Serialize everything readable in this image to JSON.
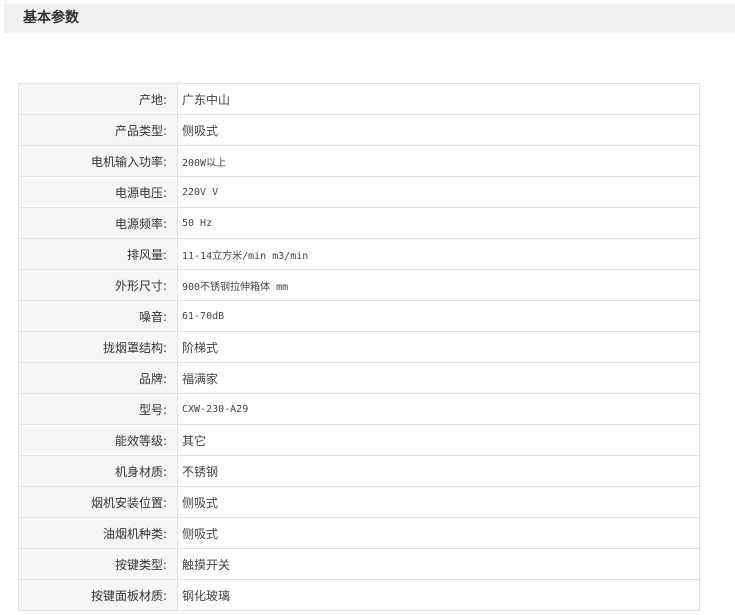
{
  "section": {
    "title": "基本参数"
  },
  "params": [
    {
      "label": "产地:",
      "value": "广东中山"
    },
    {
      "label": "产品类型:",
      "value": "侧吸式"
    },
    {
      "label": "电机输入功率:",
      "value": "200W以上"
    },
    {
      "label": "电源电压:",
      "value": "220V V"
    },
    {
      "label": "电源频率:",
      "value": "50 Hz"
    },
    {
      "label": "排风量:",
      "value": "11-14立方米/min m3/min"
    },
    {
      "label": "外形尺寸:",
      "value": "900不锈钢拉伸箱体 mm"
    },
    {
      "label": "噪音:",
      "value": "61-70dB"
    },
    {
      "label": "拢烟罩结构:",
      "value": "阶梯式"
    },
    {
      "label": "品牌:",
      "value": "福满家"
    },
    {
      "label": "型号:",
      "value": "CXW-230-A29"
    },
    {
      "label": "能效等级:",
      "value": "其它"
    },
    {
      "label": "机身材质:",
      "value": "不锈钢"
    },
    {
      "label": "烟机安装位置:",
      "value": "侧吸式"
    },
    {
      "label": "油烟机种类:",
      "value": "侧吸式"
    },
    {
      "label": "按键类型:",
      "value": "触摸开关"
    },
    {
      "label": "按键面板材质:",
      "value": "钢化玻璃"
    }
  ]
}
